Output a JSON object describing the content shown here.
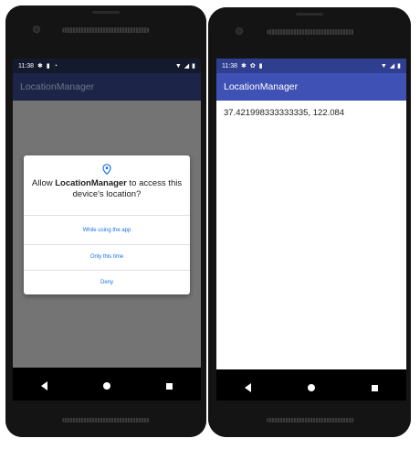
{
  "left_phone": {
    "status_bar": {
      "time": "11:38",
      "icons": [
        "gear-icon",
        "sd-card-icon",
        "sync-icon"
      ],
      "right_icons": [
        "wifi-icon",
        "signal-icon",
        "battery-icon"
      ]
    },
    "app_bar": {
      "title": "LocationManager"
    },
    "dialog": {
      "title_prefix": "Allow ",
      "title_app": "LocationManager",
      "title_suffix": " to access this device's location?",
      "options": [
        "While using the app",
        "Only this time",
        "Deny"
      ],
      "accent_color": "#1a73e8"
    },
    "nav": [
      "back-icon",
      "home-icon",
      "recents-icon"
    ]
  },
  "right_phone": {
    "status_bar": {
      "time": "11:38",
      "icons": [
        "gear-icon",
        "settings-icon",
        "sd-card-icon"
      ],
      "right_icons": [
        "wifi-icon",
        "signal-icon",
        "battery-icon"
      ]
    },
    "app_bar": {
      "title": "LocationManager",
      "color": "#3f51b5"
    },
    "content": {
      "coordinates": "37.421998333333335,  122.084"
    },
    "nav": [
      "back-icon",
      "home-icon",
      "recents-icon"
    ]
  }
}
